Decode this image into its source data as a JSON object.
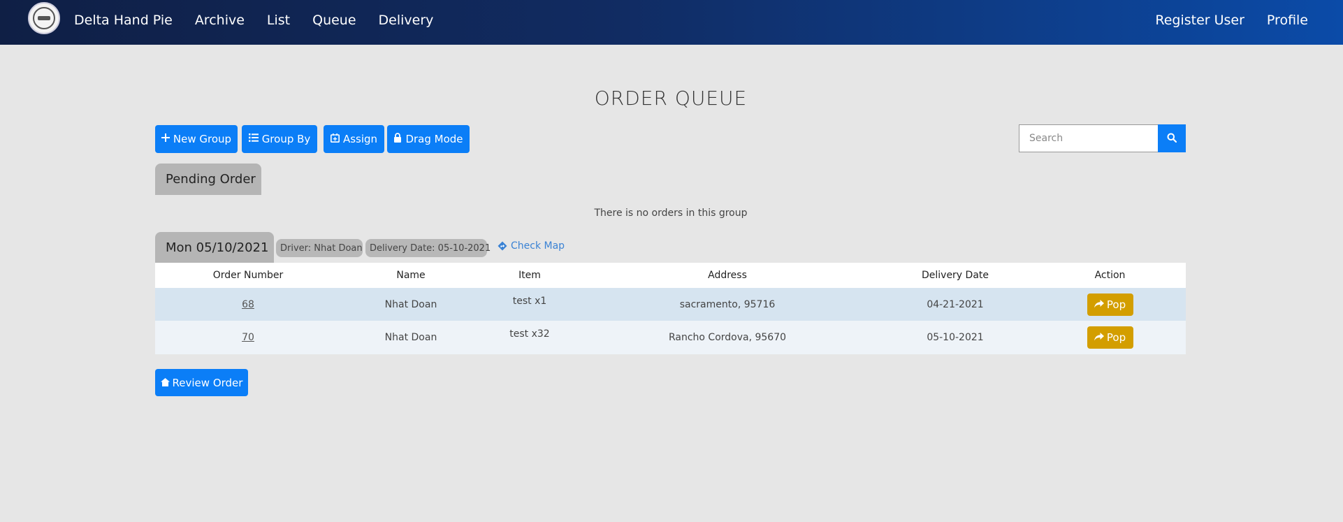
{
  "navbar": {
    "brand": "Delta Hand Pie",
    "links": [
      "Archive",
      "List",
      "Queue",
      "Delivery"
    ],
    "right_links": [
      "Register User",
      "Profile"
    ],
    "logo_icon": "seal-logo-icon"
  },
  "page": {
    "title": "ORDER QUEUE"
  },
  "toolbar": {
    "new_group": "New Group",
    "group_by": "Group By",
    "assign": "Assign",
    "drag_mode": "Drag Mode",
    "search_placeholder": "Search"
  },
  "pending": {
    "title": "Pending Order",
    "empty_message": "There is no orders in this group"
  },
  "group": {
    "title": "Mon 05/10/2021",
    "driver": "Driver: Nhat Doan",
    "delivery_date": "Delivery Date: 05-10-2021",
    "check_map": "Check Map",
    "columns": [
      "Order Number",
      "Name",
      "Item",
      "Address",
      "Delivery Date",
      "Action"
    ],
    "rows": [
      {
        "order_number": "68",
        "name": "Nhat Doan",
        "item": "test x1",
        "address": "sacramento, 95716",
        "delivery_date": "04-21-2021",
        "action": "Pop"
      },
      {
        "order_number": "70",
        "name": "Nhat Doan",
        "item": "test x32",
        "address": "Rancho Cordova, 95670",
        "delivery_date": "05-10-2021",
        "action": "Pop"
      }
    ]
  },
  "footer_actions": {
    "review_order": "Review Order"
  },
  "colors": {
    "primary": "#0b7ef7",
    "warning": "#d39e00",
    "nav_start": "#0f1f45",
    "nav_end": "#0b4ba8",
    "background": "#e6e6e6"
  }
}
